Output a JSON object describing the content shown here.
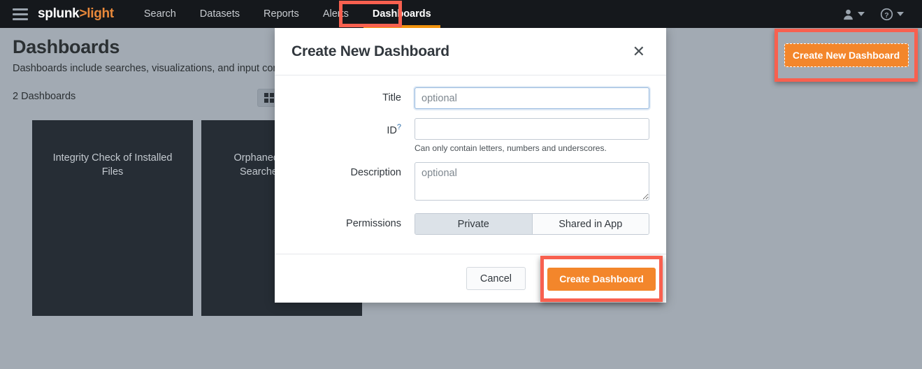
{
  "nav": {
    "menu_icon": "hamburger-icon",
    "brand_primary": "splunk",
    "brand_arrow": ">",
    "brand_secondary": "light",
    "links": [
      {
        "label": "Search",
        "active": false
      },
      {
        "label": "Datasets",
        "active": false
      },
      {
        "label": "Reports",
        "active": false
      },
      {
        "label": "Alerts",
        "active": false
      },
      {
        "label": "Dashboards",
        "active": true
      }
    ],
    "user_icon": "user-icon",
    "help_icon": "help-question-icon"
  },
  "page": {
    "title": "Dashboards",
    "subtitle": "Dashboards include searches, visualizations, and input controls",
    "count_label": "2 Dashboards",
    "view_toggle_icon": "grid-view-icon",
    "create_button_label": "Create New Dashboard",
    "cards": [
      {
        "title": "Integrity Check of Installed Files"
      },
      {
        "title": "Orphaned Scheduled Searches, Reports"
      }
    ]
  },
  "modal": {
    "title": "Create New Dashboard",
    "close_icon": "close-icon",
    "fields": {
      "title": {
        "label": "Title",
        "value": "",
        "placeholder": "optional"
      },
      "id": {
        "label": "ID",
        "help_marker": "?",
        "value": "",
        "placeholder": "",
        "hint": "Can only contain letters, numbers and underscores."
      },
      "description": {
        "label": "Description",
        "value": "",
        "placeholder": "optional"
      },
      "permissions": {
        "label": "Permissions",
        "options": [
          {
            "label": "Private",
            "selected": true
          },
          {
            "label": "Shared in App",
            "selected": false
          }
        ]
      }
    },
    "cancel_label": "Cancel",
    "submit_label": "Create Dashboard"
  },
  "annotations": {
    "highlight_color": "#f8604f",
    "accent_orange": "#f3862b",
    "boxes": [
      {
        "target": "nav-tab-dashboards"
      },
      {
        "target": "create-new-dashboard-button"
      },
      {
        "target": "create-dashboard-submit-button"
      }
    ]
  }
}
